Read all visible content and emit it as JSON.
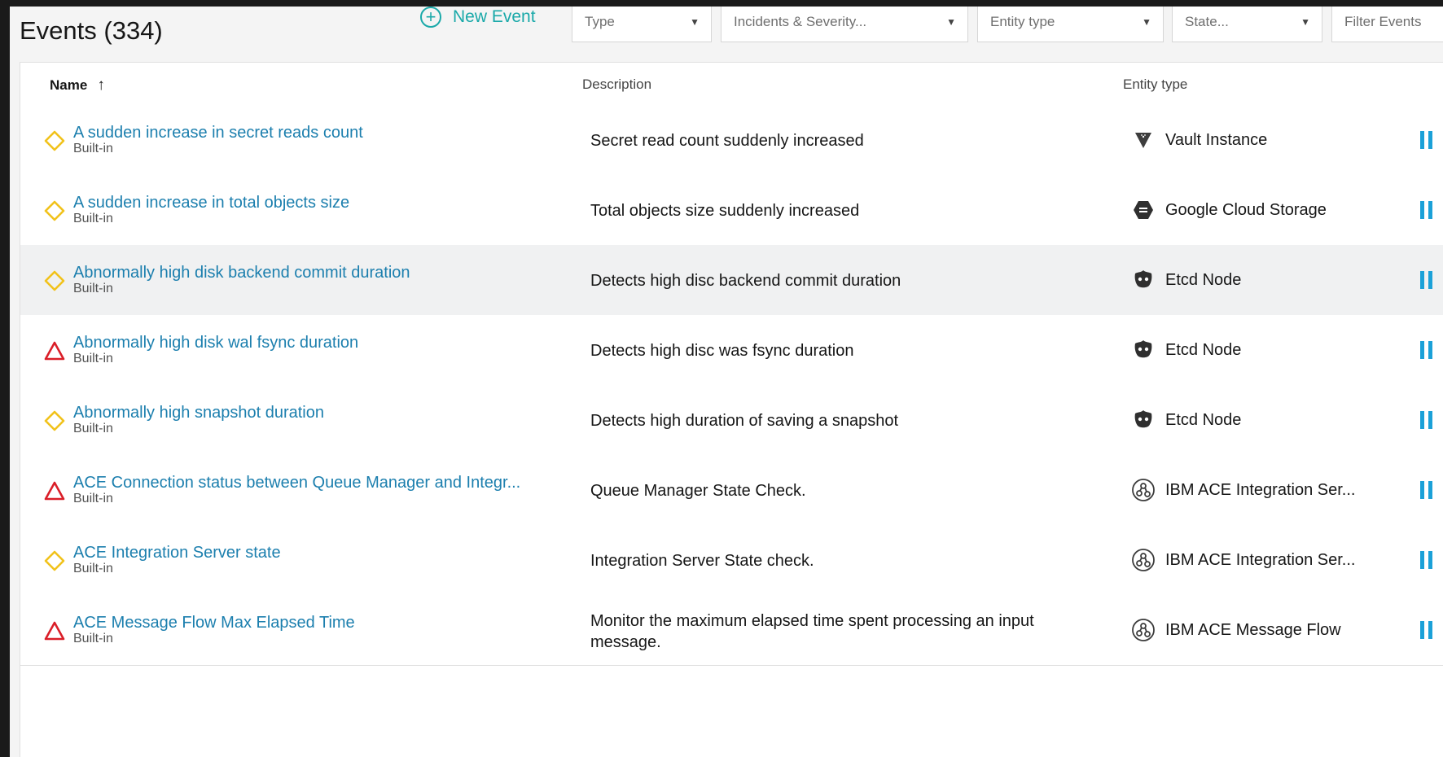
{
  "header": {
    "title": "Events (334)",
    "new_event_label": "New Event",
    "filters": [
      {
        "label": "Type"
      },
      {
        "label": "Incidents & Severity..."
      },
      {
        "label": "Entity type"
      },
      {
        "label": "State..."
      },
      {
        "label": "Filter Events"
      }
    ]
  },
  "table": {
    "columns": {
      "name": "Name",
      "description": "Description",
      "entity_type": "Entity type"
    },
    "sort_indicator": "ascending",
    "rows": [
      {
        "name": "A sudden increase in secret reads count",
        "sub": "Built-in",
        "description": "Secret read count suddenly increased",
        "entity": "Vault Instance",
        "entity_icon": "vault-icon",
        "severity": "warning"
      },
      {
        "name": "A sudden increase in total objects size",
        "sub": "Built-in",
        "description": "Total objects size suddenly increased",
        "entity": "Google Cloud Storage",
        "entity_icon": "cloud-storage-icon",
        "severity": "warning"
      },
      {
        "name": "Abnormally high disk backend commit duration",
        "sub": "Built-in",
        "description": "Detects high disc backend commit duration",
        "entity": "Etcd Node",
        "entity_icon": "etcd-icon",
        "severity": "warning"
      },
      {
        "name": "Abnormally high disk wal fsync duration",
        "sub": "Built-in",
        "description": "Detects high disc was fsync duration",
        "entity": "Etcd Node",
        "entity_icon": "etcd-icon",
        "severity": "critical"
      },
      {
        "name": "Abnormally high snapshot duration",
        "sub": "Built-in",
        "description": "Detects high duration of saving a snapshot",
        "entity": "Etcd Node",
        "entity_icon": "etcd-icon",
        "severity": "warning"
      },
      {
        "name": "ACE Connection status between Queue Manager and Integr...",
        "sub": "Built-in",
        "description": "Queue Manager State Check.",
        "entity": "IBM ACE Integration Ser...",
        "entity_icon": "ibm-ace-icon",
        "severity": "critical"
      },
      {
        "name": "ACE Integration Server state",
        "sub": "Built-in",
        "description": "Integration Server State check.",
        "entity": "IBM ACE Integration Ser...",
        "entity_icon": "ibm-ace-icon",
        "severity": "warning"
      },
      {
        "name": "ACE Message Flow Max Elapsed Time",
        "sub": "Built-in",
        "description": "Monitor the maximum elapsed time spent processing an input message.",
        "entity": "IBM ACE Message Flow",
        "entity_icon": "ibm-ace-icon",
        "severity": "critical"
      }
    ]
  },
  "colors": {
    "link": "#1c7fae",
    "warning": "#f1c21b",
    "critical": "#da1e28",
    "pause": "#1ba1d8",
    "accent": "#1aa9a9"
  }
}
